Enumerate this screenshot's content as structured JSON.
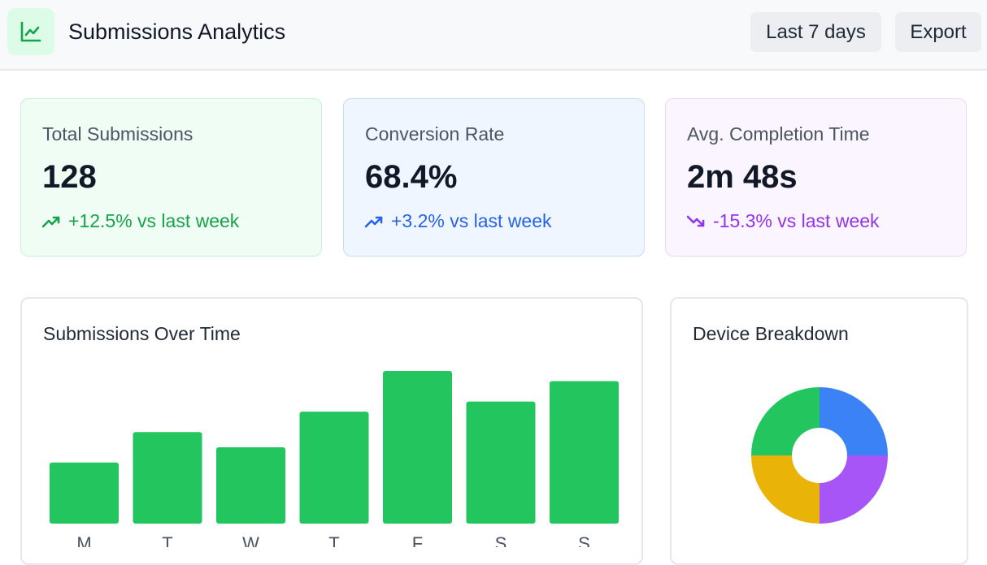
{
  "header": {
    "title": "Submissions Analytics",
    "logo_icon": "line-chart-icon",
    "range_label": "Last 7 days",
    "export_label": "Export"
  },
  "stats": [
    {
      "label": "Total Submissions",
      "value": "128",
      "trend": "+12.5% vs last week",
      "trend_icon": "trending-up-icon",
      "accent": "#16a34a"
    },
    {
      "label": "Conversion Rate",
      "value": "68.4%",
      "trend": "+3.2% vs last week",
      "trend_icon": "trending-up-icon",
      "accent": "#2563eb"
    },
    {
      "label": "Avg. Completion Time",
      "value": "2m 48s",
      "trend": "-15.3% vs last week",
      "trend_icon": "trending-down-icon",
      "accent": "#9333ea"
    }
  ],
  "submissions_panel": {
    "title": "Submissions Over Time"
  },
  "device_panel": {
    "title": "Device Breakdown"
  },
  "chart_data": [
    {
      "type": "bar",
      "categories": [
        "M",
        "T",
        "W",
        "T",
        "F",
        "S",
        "S"
      ],
      "values": [
        12,
        18,
        15,
        22,
        30,
        24,
        28
      ],
      "color": "#22c55e"
    },
    {
      "type": "pie",
      "slices": [
        {
          "value": 25,
          "color": "#3b82f6"
        },
        {
          "value": 25,
          "color": "#a855f7"
        },
        {
          "value": 25,
          "color": "#eab308"
        },
        {
          "value": 25,
          "color": "#22c55e"
        }
      ]
    }
  ]
}
